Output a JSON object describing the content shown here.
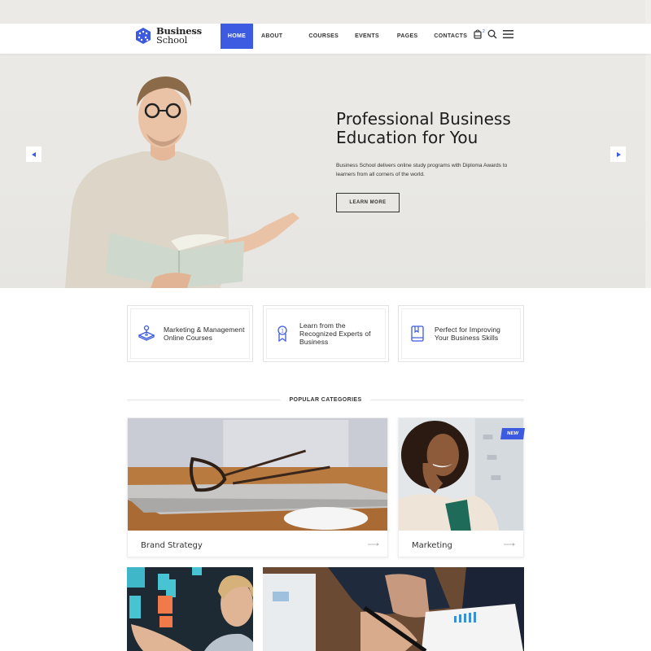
{
  "brand": {
    "name_line1": "Business",
    "name_line2": "School",
    "accent_color": "#3d5be0"
  },
  "nav": {
    "items": [
      {
        "label": "HOME",
        "active": true
      },
      {
        "label": "ABOUT",
        "active": false
      },
      {
        "label": "COURSES",
        "active": false
      },
      {
        "label": "EVENTS",
        "active": false
      },
      {
        "label": "PAGES",
        "active": false
      },
      {
        "label": "CONTACTS",
        "active": false
      }
    ]
  },
  "tools": {
    "cart_icon": "shopping-bag-icon",
    "cart_count": "2",
    "search_icon": "search-icon",
    "menu_icon": "hamburger-menu-icon"
  },
  "hero": {
    "title_line1": "Professional Business",
    "title_line2": "Education for You",
    "description": "Business School delivers online study programs with Diploma Awards to learners from all corners of the world.",
    "button_label": "LEARN MORE",
    "prev_icon": "arrow-left-icon",
    "next_icon": "arrow-right-icon"
  },
  "features": [
    {
      "icon": "joystick-icon",
      "text": "Marketing & Management Online Courses"
    },
    {
      "icon": "award-ribbon-icon",
      "text": "Learn from the Recognized Experts of Business"
    },
    {
      "icon": "book-icon",
      "text": "Perfect for Improving Your Business Skills"
    }
  ],
  "categories": {
    "heading": "POPULAR CATEGORIES",
    "items": [
      {
        "label": "Brand Strategy",
        "badge": ""
      },
      {
        "label": "Marketing",
        "badge": "NEW"
      }
    ]
  }
}
